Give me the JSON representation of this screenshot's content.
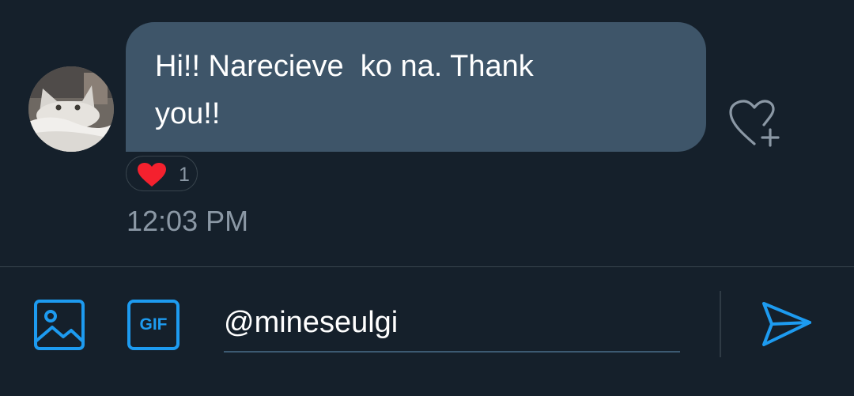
{
  "conversation": {
    "message": {
      "text": "Hi!! Narecieve  ko na. Thank\nyou!!",
      "reaction": {
        "icon": "heart-icon",
        "color": "#f91880",
        "count": "1"
      },
      "timestamp": "12:03 PM"
    },
    "add_reaction_icon": "heart-plus-icon"
  },
  "composer": {
    "media_icon": "image-icon",
    "gif_label": "GIF",
    "input_value": "@mineseulgi",
    "send_icon": "send-icon"
  },
  "colors": {
    "background": "#15202b",
    "bubble": "#3e5569",
    "accent": "#1d9bf0",
    "muted_text": "#8b98a5",
    "heart": "#f4212e"
  }
}
